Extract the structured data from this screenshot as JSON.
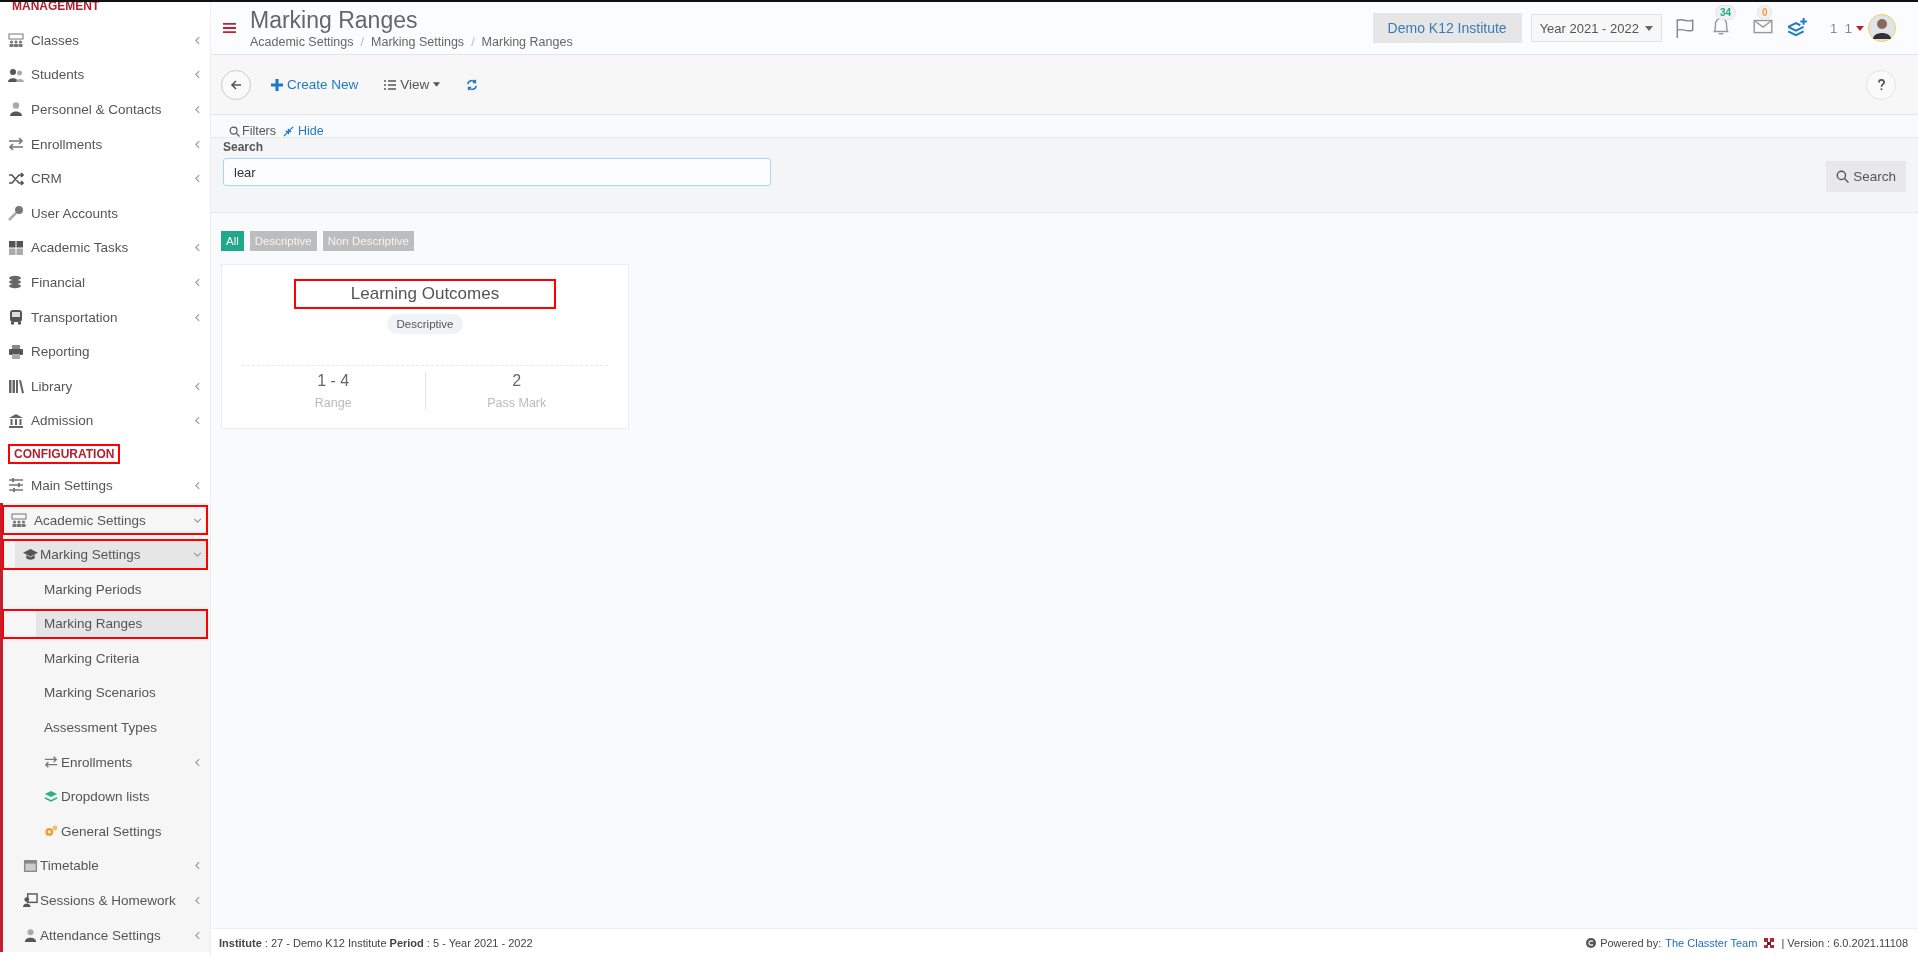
{
  "sidebar": {
    "sections": [
      {
        "title": "MANAGEMENT",
        "highlighted": false,
        "items": [
          {
            "label": "Classes",
            "submenu": true,
            "expanded": false,
            "selected": false,
            "highlighted": false
          },
          {
            "label": "Students",
            "submenu": true,
            "expanded": false,
            "selected": false,
            "highlighted": false
          },
          {
            "label": "Personnel & Contacts",
            "submenu": true,
            "expanded": false,
            "selected": false,
            "highlighted": false
          },
          {
            "label": "Enrollments",
            "submenu": true,
            "expanded": false,
            "selected": false,
            "highlighted": false
          },
          {
            "label": "CRM",
            "submenu": true,
            "expanded": false,
            "selected": false,
            "highlighted": false
          },
          {
            "label": "User Accounts",
            "submenu": false,
            "expanded": false,
            "selected": false,
            "highlighted": false
          },
          {
            "label": "Academic Tasks",
            "submenu": true,
            "expanded": false,
            "selected": false,
            "highlighted": false
          },
          {
            "label": "Financial",
            "submenu": true,
            "expanded": false,
            "selected": false,
            "highlighted": false
          },
          {
            "label": "Transportation",
            "submenu": true,
            "expanded": false,
            "selected": false,
            "highlighted": false
          },
          {
            "label": "Reporting",
            "submenu": false,
            "expanded": false,
            "selected": false,
            "highlighted": false
          },
          {
            "label": "Library",
            "submenu": true,
            "expanded": false,
            "selected": false,
            "highlighted": false
          },
          {
            "label": "Admission",
            "submenu": true,
            "expanded": false,
            "selected": false,
            "highlighted": false
          }
        ]
      },
      {
        "title": "CONFIGURATION",
        "highlighted": true,
        "items": [
          {
            "label": "Main Settings",
            "submenu": true,
            "expanded": false,
            "selected": false,
            "highlighted": false
          },
          {
            "label": "Academic Settings",
            "submenu": true,
            "expanded": true,
            "selected": false,
            "highlighted": true,
            "children": [
              {
                "label": "Marking Settings",
                "submenu": true,
                "expanded": true,
                "selected": false,
                "highlighted": true,
                "children": [
                  {
                    "label": "Marking Periods",
                    "submenu": false,
                    "expanded": false,
                    "selected": false,
                    "highlighted": false
                  },
                  {
                    "label": "Marking Ranges",
                    "submenu": false,
                    "expanded": false,
                    "selected": true,
                    "highlighted": true
                  },
                  {
                    "label": "Marking Criteria",
                    "submenu": false,
                    "expanded": false,
                    "selected": false,
                    "highlighted": false
                  },
                  {
                    "label": "Marking Scenarios",
                    "submenu": false,
                    "expanded": false,
                    "selected": false,
                    "highlighted": false
                  },
                  {
                    "label": "Assessment Types",
                    "submenu": false,
                    "expanded": false,
                    "selected": false,
                    "highlighted": false
                  },
                  {
                    "label": "Enrollments",
                    "submenu": true,
                    "expanded": false,
                    "selected": false,
                    "highlighted": false
                  },
                  {
                    "label": "Dropdown lists",
                    "submenu": false,
                    "expanded": false,
                    "selected": false,
                    "highlighted": false
                  },
                  {
                    "label": "General Settings",
                    "submenu": false,
                    "expanded": false,
                    "selected": false,
                    "highlighted": false
                  }
                ]
              },
              {
                "label": "Timetable",
                "submenu": true,
                "expanded": false,
                "selected": false,
                "highlighted": false
              },
              {
                "label": "Sessions & Homework",
                "submenu": true,
                "expanded": false,
                "selected": false,
                "highlighted": false
              },
              {
                "label": "Attendance Settings",
                "submenu": true,
                "expanded": false,
                "selected": false,
                "highlighted": false
              }
            ]
          }
        ]
      }
    ]
  },
  "header": {
    "title": "Marking Ranges",
    "breadcrumb": [
      "Academic Settings",
      "Marking Settings",
      "Marking Ranges"
    ],
    "breadcrumb_separator": "/",
    "institute": "Demo K12 Institute",
    "year": "Year 2021 - 2022",
    "notifications": "34",
    "messages": "0",
    "user": "1 1"
  },
  "toolbar": {
    "create": "Create New",
    "view": "View"
  },
  "filters": {
    "title": "Filters",
    "hide": "Hide",
    "search_label": "Search",
    "search_value": "lear",
    "search_button": "Search"
  },
  "type_filters": [
    {
      "label": "All",
      "selected": true
    },
    {
      "label": "Descriptive",
      "selected": false
    },
    {
      "label": "Non Descriptive",
      "selected": false
    }
  ],
  "cards": [
    {
      "title": "Learning Outcomes",
      "highlighted": true,
      "type": "Descriptive",
      "range": "1 - 4",
      "range_label": "Range",
      "pass_mark": "2",
      "pass_mark_label": "Pass Mark"
    }
  ],
  "footer": {
    "info": "**Institute** : 27 - Demo K12 Institute **Period** : 5 - Year 2021 - 2022",
    "powered": "Powered by:",
    "team": "The Classter Team",
    "version": "| Version : 6.0.2021.11108"
  }
}
